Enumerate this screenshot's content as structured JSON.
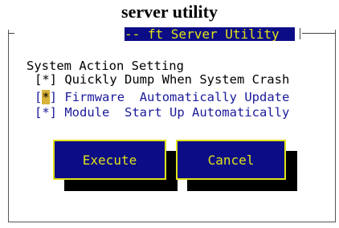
{
  "caption": "server utility",
  "window": {
    "title": "-- ft Server Utility"
  },
  "panel": {
    "section_label": "System Action Setting",
    "options": [
      {
        "mark": "[*]",
        "label": "Quickly Dump When System Crash"
      },
      {
        "mark": "*",
        "label": "Firmware  Automatically Update"
      },
      {
        "mark": "[*]",
        "label": "Module  Start Up Automatically"
      }
    ]
  },
  "buttons": {
    "execute": "Execute",
    "cancel": "Cancel"
  },
  "colors": {
    "screen_bg": "#0b0c86",
    "accent_text": "#e2e21a",
    "option_text": "#1a1a9a",
    "highlight": "#d8b33a"
  }
}
